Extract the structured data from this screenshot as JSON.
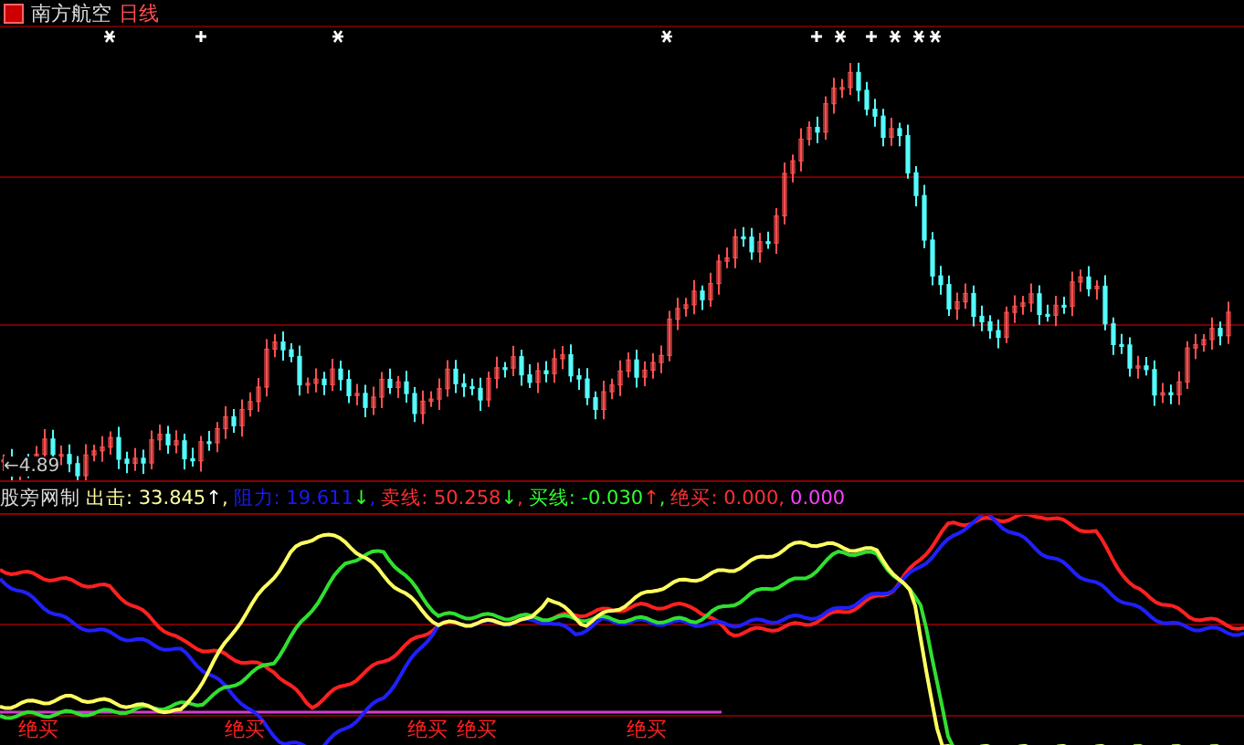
{
  "header": {
    "stock": "南方航空",
    "period": "日线"
  },
  "price_chart": {
    "low_label": "←4.89"
  },
  "indicator": {
    "name": "股旁网制",
    "readings": [
      {
        "text": "出击: 33.845",
        "arrow": {
          "symbol": "↑",
          "color": "#ffffff"
        },
        "separator": ",",
        "color": "#ffffa0"
      },
      {
        "text": "阻力: 19.611",
        "arrow": {
          "symbol": "↓",
          "color": "#30ff30"
        },
        "separator": ",",
        "color": "#1a1aff"
      },
      {
        "text": "卖线: 50.258",
        "arrow": {
          "symbol": "↓",
          "color": "#30ff30"
        },
        "separator": ",",
        "color": "#ff3030"
      },
      {
        "text": "买线: -0.030",
        "arrow": {
          "symbol": "↑",
          "color": "#ff3030"
        },
        "separator": ",",
        "color": "#30ff30"
      },
      {
        "text": "绝买: 0.000",
        "separator": ",",
        "color": "#ff3030"
      },
      {
        "text": "0.000",
        "color": "#ff40ff"
      }
    ],
    "signals": [
      "绝买",
      "绝买",
      "绝买",
      "绝买",
      "绝买"
    ]
  }
}
